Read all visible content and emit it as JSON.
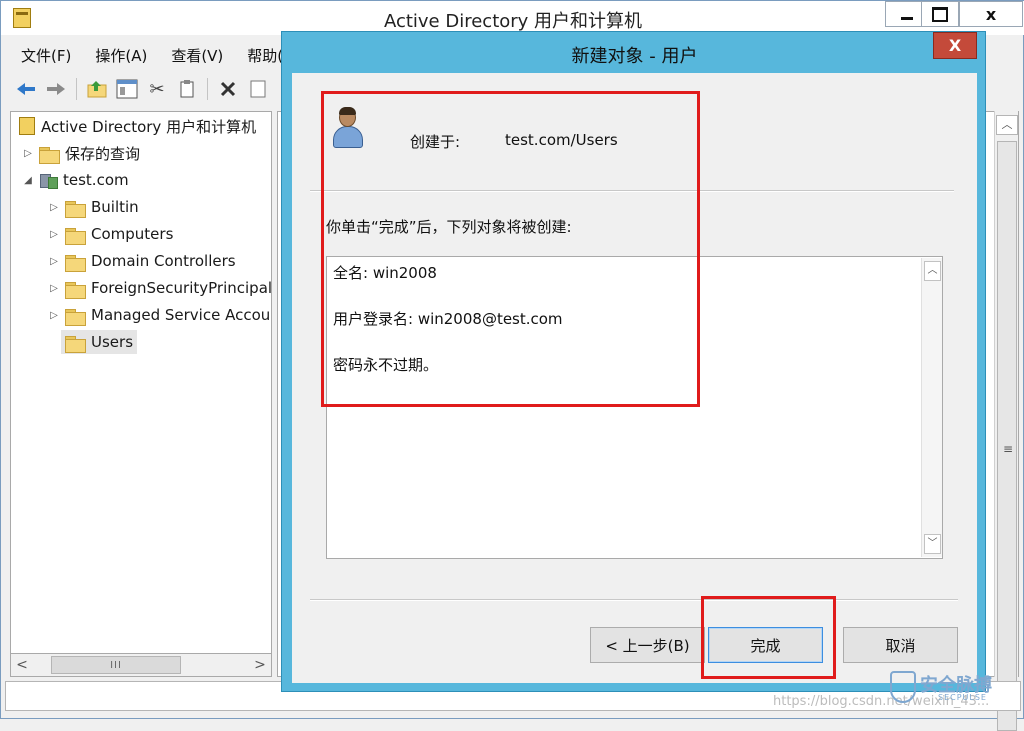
{
  "app": {
    "title": "Active Directory 用户和计算机",
    "close_glyph": "x"
  },
  "menu": [
    "文件(F)",
    "操作(A)",
    "查看(V)",
    "帮助("
  ],
  "toolbar": {
    "icons": [
      "back-arrow-icon",
      "forward-arrow-icon",
      "up-folder-icon",
      "show-tree-icon",
      "cut-icon",
      "copy-icon",
      "delete-icon",
      "properties-icon"
    ]
  },
  "tree": {
    "root": "Active Directory 用户和计算机",
    "saved_queries": "保存的查询",
    "domain": "test.com",
    "children": [
      "Builtin",
      "Computers",
      "Domain Controllers",
      "ForeignSecurityPrincipals",
      "Managed Service Accounts",
      "Users"
    ],
    "selected": "Users"
  },
  "tree_scroll": {
    "thumb_grip": "III"
  },
  "right_scroll": {
    "grip": "≡"
  },
  "dialog": {
    "title": "新建对象 - 用户",
    "close_label": "X",
    "create_in_label": "创建于:",
    "create_in_value": "test.com/Users",
    "instruction": "你单击“完成”后，下列对象将被创建:",
    "summary": [
      "全名: win2008",
      "用户登录名: win2008@test.com",
      "密码永不过期。"
    ],
    "buttons": {
      "back": "< 上一步(B)",
      "finish": "完成",
      "cancel": "取消"
    }
  },
  "watermark": {
    "url": "https://blog.csdn.net/weixin_43...",
    "brand": "安全脉搏",
    "brand_sub": "SECPULSE"
  },
  "colors": {
    "dialog_frame": "#57b7dc",
    "annotation_red": "#e01b1b",
    "close_red": "#c44a3a"
  }
}
